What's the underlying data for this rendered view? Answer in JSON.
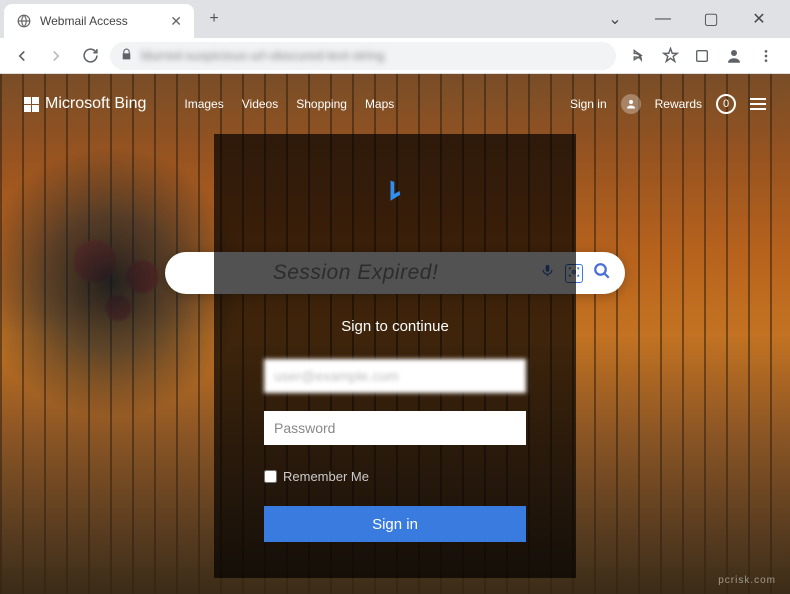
{
  "browser": {
    "tab_title": "Webmail Access",
    "address_text": "blurred-suspicious-url-obscured-text-string",
    "window_controls": {
      "min": "—",
      "max": "▢",
      "close": "✕"
    },
    "new_tab": "+"
  },
  "bing": {
    "brand": "Microsoft Bing",
    "nav": {
      "images": "Images",
      "videos": "Videos",
      "shopping": "Shopping",
      "maps": "Maps"
    },
    "signin": "Sign in",
    "rewards": "Rewards",
    "rewards_val": "0"
  },
  "search": {
    "placeholder_display": "Session Expired!"
  },
  "modal": {
    "subtitle": "Sign to continue",
    "email_value": "user@example.com",
    "password_placeholder": "Password",
    "remember_label": "Remember Me",
    "signin_label": "Sign in"
  },
  "watermark": "pcrisk.com"
}
